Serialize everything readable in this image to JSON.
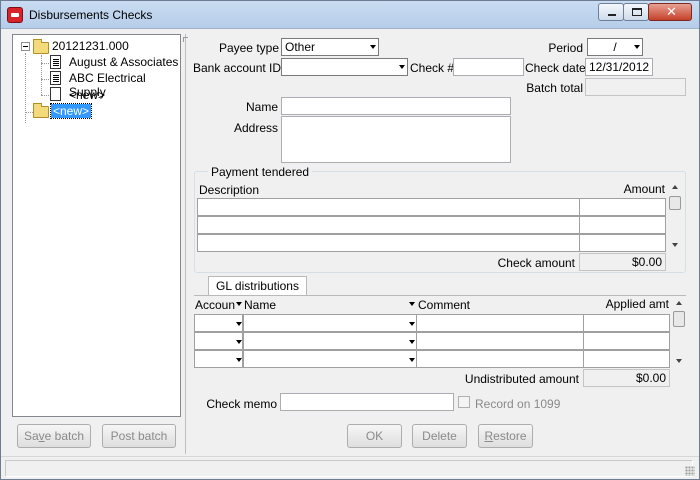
{
  "window": {
    "title": "Disbursements Checks",
    "close_glyph": "✕"
  },
  "tree": {
    "batch_label": "20121231.000",
    "checks": [
      "August & Associates",
      "ABC Electrical Supply",
      "<new>"
    ],
    "new_batch_label": "<new>"
  },
  "left_buttons": {
    "save_prefix": "Sa",
    "save_underline": "v",
    "save_suffix": "e batch",
    "post_label": "Post batch"
  },
  "header": {
    "payee_type_label": "Payee type",
    "payee_type_value": "Other",
    "bank_account_label": "Bank account ID",
    "bank_account_value": "",
    "check_no_label": "Check #",
    "check_no_value": "",
    "period_label": "Period",
    "period_value": "/",
    "check_date_label": "Check date",
    "check_date_value": "12/31/2012",
    "batch_total_label": "Batch total",
    "batch_total_value": "",
    "name_label": "Name",
    "name_value": "",
    "address_label": "Address",
    "address_value": ""
  },
  "payment": {
    "group_label": "Payment tendered",
    "col_description": "Description",
    "col_amount": "Amount",
    "check_amount_label": "Check amount",
    "check_amount_value": "$0.00"
  },
  "gl": {
    "tab_label": "GL distributions",
    "col_account": "Accoun",
    "col_name": "Name",
    "col_comment": "Comment",
    "col_applied": "Applied amt",
    "undistributed_label": "Undistributed amount",
    "undistributed_value": "$0.00"
  },
  "memo": {
    "label": "Check memo",
    "value": "",
    "record_1099_label": "Record on 1099",
    "record_1099_checked": false
  },
  "actions": {
    "ok_label": "OK",
    "delete_label": "Delete",
    "restore_prefix": "",
    "restore_underline": "R",
    "restore_suffix": "estore"
  }
}
